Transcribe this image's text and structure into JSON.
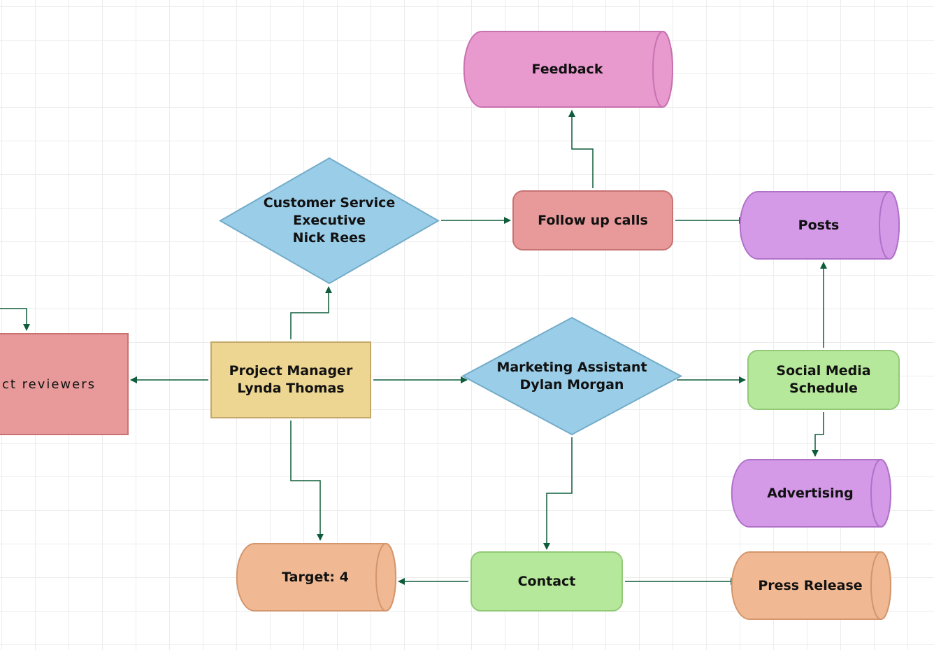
{
  "diagram": {
    "type": "flowchart",
    "nodes": {
      "feedback": {
        "label": "Feedback",
        "shape": "cylinder",
        "fill": "#e89acf",
        "stroke": "#c972b0"
      },
      "customer_service": {
        "label": "Customer Service\nExecutive\nNick Rees",
        "shape": "diamond",
        "fill": "#9acde8",
        "stroke": "#74acc9"
      },
      "follow_up": {
        "label": "Follow up calls",
        "shape": "rounded-rect",
        "fill": "#e89a9a",
        "stroke": "#c97272"
      },
      "posts": {
        "label": "Posts",
        "shape": "cylinder",
        "fill": "#d49ae8",
        "stroke": "#b072c9"
      },
      "reviewers": {
        "label": "ct reviewers",
        "shape": "rect",
        "fill": "#e89a9a",
        "stroke": "#c97272"
      },
      "project_manager": {
        "label": "Project Manager\nLynda Thomas",
        "shape": "rect",
        "fill": "#edd592",
        "stroke": "#c4a96a"
      },
      "marketing_assistant": {
        "label": "Marketing Assistant\nDylan Morgan",
        "shape": "diamond",
        "fill": "#9acde8",
        "stroke": "#74acc9"
      },
      "social_media": {
        "label": "Social Media\nSchedule",
        "shape": "rounded-rect",
        "fill": "#b5e89a",
        "stroke": "#92c977"
      },
      "advertising": {
        "label": "Advertising",
        "shape": "cylinder",
        "fill": "#d49ae8",
        "stroke": "#b072c9"
      },
      "target": {
        "label": "Target: 4",
        "shape": "cylinder",
        "fill": "#f0b994",
        "stroke": "#d4966c"
      },
      "contact": {
        "label": "Contact",
        "shape": "rounded-rect",
        "fill": "#b5e89a",
        "stroke": "#92c977"
      },
      "press_release": {
        "label": "Press Release",
        "shape": "cylinder",
        "fill": "#f0b994",
        "stroke": "#d4966c"
      }
    },
    "edges": [
      {
        "from": "project_manager",
        "to": "customer_service"
      },
      {
        "from": "project_manager",
        "to": "reviewers"
      },
      {
        "from": "project_manager",
        "to": "marketing_assistant"
      },
      {
        "from": "project_manager",
        "to": "target"
      },
      {
        "from": "customer_service",
        "to": "follow_up"
      },
      {
        "from": "follow_up",
        "to": "feedback"
      },
      {
        "from": "follow_up",
        "to": "posts"
      },
      {
        "from": "marketing_assistant",
        "to": "social_media"
      },
      {
        "from": "marketing_assistant",
        "to": "contact"
      },
      {
        "from": "social_media",
        "to": "posts"
      },
      {
        "from": "social_media",
        "to": "advertising"
      },
      {
        "from": "contact",
        "to": "target"
      },
      {
        "from": "contact",
        "to": "press_release"
      },
      {
        "from": "offscreen",
        "to": "reviewers"
      }
    ],
    "edge_color": "#0f5c3a"
  }
}
